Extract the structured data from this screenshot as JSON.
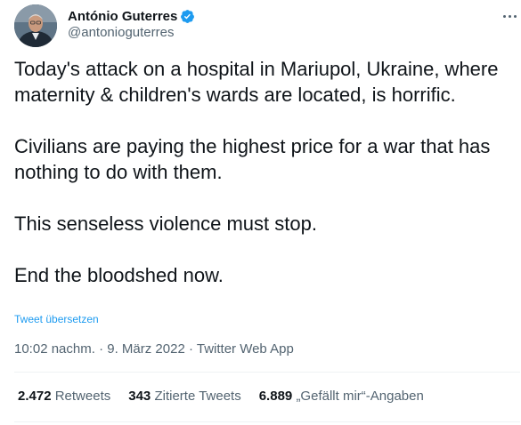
{
  "author": {
    "display_name": "António Guterres",
    "handle": "@antonioguterres",
    "verified_icon": "verified-badge-icon"
  },
  "tweet": {
    "paragraphs": [
      "Today's attack on a hospital in Mariupol, Ukraine, where maternity & children's wards are located, is horrific.",
      "Civilians are paying the highest price for a war that has nothing to do with them.",
      "This senseless violence must stop.",
      "End the bloodshed now."
    ],
    "translate_label": "Tweet übersetzen"
  },
  "meta": {
    "time": "10:02 nachm.",
    "separator": " · ",
    "date": "9. März 2022",
    "source": "Twitter Web App"
  },
  "stats": {
    "retweets_count": "2.472",
    "retweets_label": "Retweets",
    "quotes_count": "343",
    "quotes_label": "Zitierte Tweets",
    "likes_count": "6.889",
    "likes_label": "„Gefällt mir“-Angaben"
  },
  "colors": {
    "accent": "#1d9bf0",
    "text_primary": "#0f1419",
    "text_secondary": "#536471",
    "divider": "#eff3f4"
  }
}
